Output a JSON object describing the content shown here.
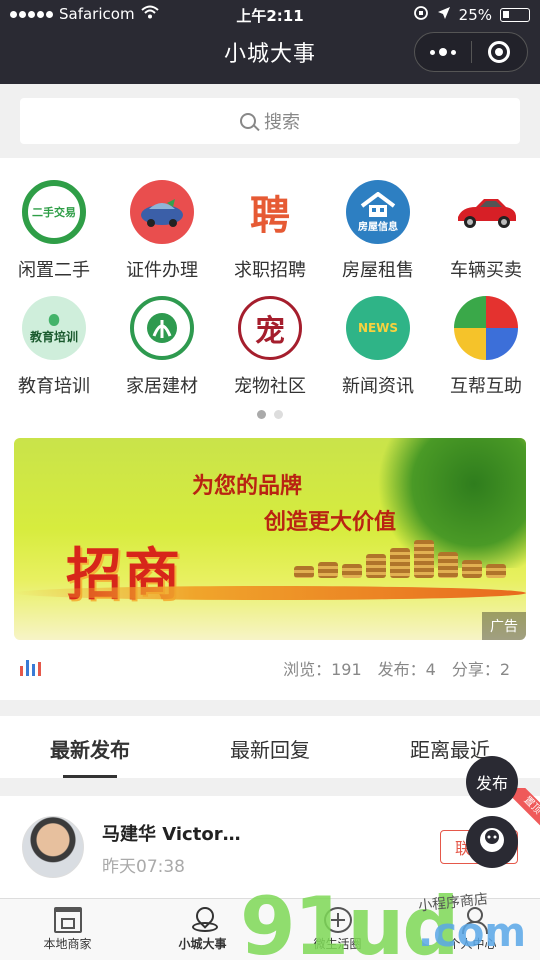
{
  "status_bar": {
    "carrier": "Safaricom",
    "time": "上午2:11",
    "battery": "25%"
  },
  "nav": {
    "title": "小城大事"
  },
  "search": {
    "placeholder": "搜索"
  },
  "categories": [
    {
      "label": "闲置二手",
      "icon": "secondhand-icon",
      "icon_text": "二手交易",
      "color": "#2f9e47"
    },
    {
      "label": "证件办理",
      "icon": "car-document-icon",
      "icon_text": "",
      "color": "#e94e4e"
    },
    {
      "label": "求职招聘",
      "icon": "hiring-icon",
      "icon_text": "聘",
      "color": "#e65a34"
    },
    {
      "label": "房屋租售",
      "icon": "house-icon",
      "icon_text": "房屋信息",
      "color": "#2d7fc2"
    },
    {
      "label": "车辆买卖",
      "icon": "red-car-icon",
      "icon_text": "",
      "color": "#d71f26"
    },
    {
      "label": "教育培训",
      "icon": "education-icon",
      "icon_text": "教育培训",
      "color": "#44b36a"
    },
    {
      "label": "家居建材",
      "icon": "building-materials-icon",
      "icon_text": "",
      "color": "#2e9a4f"
    },
    {
      "label": "宠物社区",
      "icon": "pet-icon",
      "icon_text": "宠",
      "color": "#a51e2d"
    },
    {
      "label": "新闻资讯",
      "icon": "news-icon",
      "icon_text": "NEWS",
      "color": "#2fb487"
    },
    {
      "label": "互帮互助",
      "icon": "help-icon",
      "icon_text": "",
      "color": "#e6b729"
    }
  ],
  "banner": {
    "line1": "为您的品牌",
    "line2": "创造更大价值",
    "headline": "招商",
    "ad_label": "广告"
  },
  "stats": {
    "views": "浏览：191",
    "posts": "发布：4",
    "shares": "分享：2"
  },
  "tabs": [
    "最新发布",
    "最新回复",
    "距离最近"
  ],
  "post": {
    "user": "马建华 Victor…",
    "time": "昨天07:38",
    "contact": "联系",
    "pin_label": "置顶"
  },
  "float_buttons": {
    "publish": "发布"
  },
  "bottom_tabs": [
    {
      "label": "本地商家",
      "icon": "shop-icon"
    },
    {
      "label": "小城大事",
      "icon": "location-icon"
    },
    {
      "label": "微生活圈",
      "icon": "add-circle-icon"
    },
    {
      "label": "个人中心",
      "icon": "person-icon"
    }
  ],
  "watermark": {
    "main": "91ud",
    "suffix": ".com",
    "tagline": "小程序商店"
  },
  "colors": {
    "nav_bg": "#2a2a33",
    "accent_red": "#e5584a",
    "pin_red": "#ef5a5a"
  }
}
